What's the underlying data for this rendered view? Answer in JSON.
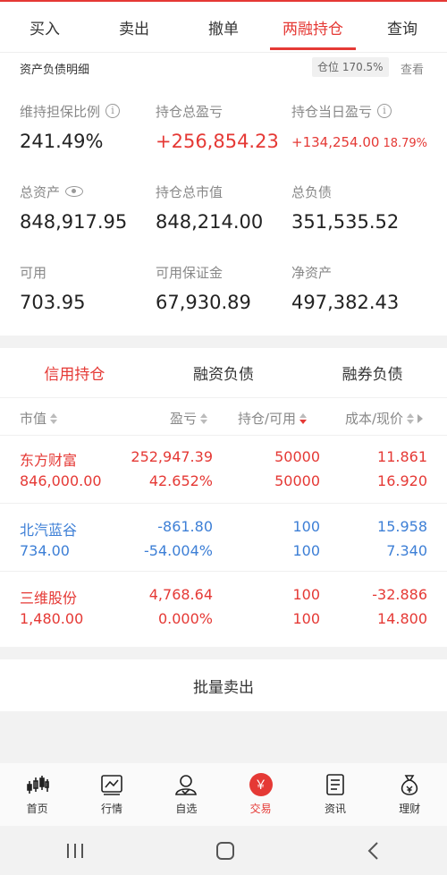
{
  "tabs": [
    {
      "label": "买入"
    },
    {
      "label": "卖出"
    },
    {
      "label": "撤单"
    },
    {
      "label": "两融持仓"
    },
    {
      "label": "查询"
    }
  ],
  "subbar": {
    "title": "资产负债明细",
    "position": "仓位 170.5%",
    "view": "查看"
  },
  "summary": {
    "maintenance_ratio": {
      "label": "维持担保比例",
      "value": "241.49%"
    },
    "total_pnl": {
      "label": "持仓总盈亏",
      "value": "+256,854.23"
    },
    "daily_pnl": {
      "label": "持仓当日盈亏",
      "value": "+134,254.00",
      "pct": "18.79%"
    },
    "total_assets": {
      "label": "总资产",
      "value": "848,917.95"
    },
    "market_value": {
      "label": "持仓总市值",
      "value": "848,214.00"
    },
    "total_liabilities": {
      "label": "总负债",
      "value": "351,535.52"
    },
    "available": {
      "label": "可用",
      "value": "703.95"
    },
    "available_margin": {
      "label": "可用保证金",
      "value": "67,930.89"
    },
    "net_assets": {
      "label": "净资产",
      "value": "497,382.43"
    }
  },
  "section_tabs": [
    {
      "label": "信用持仓"
    },
    {
      "label": "融资负债"
    },
    {
      "label": "融券负债"
    }
  ],
  "table": {
    "headers": [
      "市值",
      "盈亏",
      "持仓/可用",
      "成本/现价"
    ],
    "rows": [
      {
        "name": "东方财富",
        "market_value": "846,000.00",
        "pnl": "252,947.39",
        "pnl_pct": "42.652%",
        "holding": "50000",
        "available": "50000",
        "cost": "11.861",
        "price": "16.920"
      },
      {
        "name": "北汽蓝谷",
        "market_value": "734.00",
        "pnl": "-861.80",
        "pnl_pct": "-54.004%",
        "holding": "100",
        "available": "100",
        "cost": "15.958",
        "price": "7.340"
      },
      {
        "name": "三维股份",
        "market_value": "1,480.00",
        "pnl": "4,768.64",
        "pnl_pct": "0.000%",
        "holding": "100",
        "available": "100",
        "cost": "-32.886",
        "price": "14.800"
      }
    ]
  },
  "batch_sell": "批量卖出",
  "nav": [
    {
      "label": "首页",
      "icon": "candlestick-icon"
    },
    {
      "label": "行情",
      "icon": "chart-icon"
    },
    {
      "label": "自选",
      "icon": "user-check-icon"
    },
    {
      "label": "交易",
      "icon": "yen-icon"
    },
    {
      "label": "资讯",
      "icon": "document-icon"
    },
    {
      "label": "理财",
      "icon": "money-bag-icon"
    }
  ],
  "yen_symbol": "￥",
  "colors": {
    "accent": "#e53935",
    "up": "#e53935",
    "down": "#3d7fd6"
  }
}
